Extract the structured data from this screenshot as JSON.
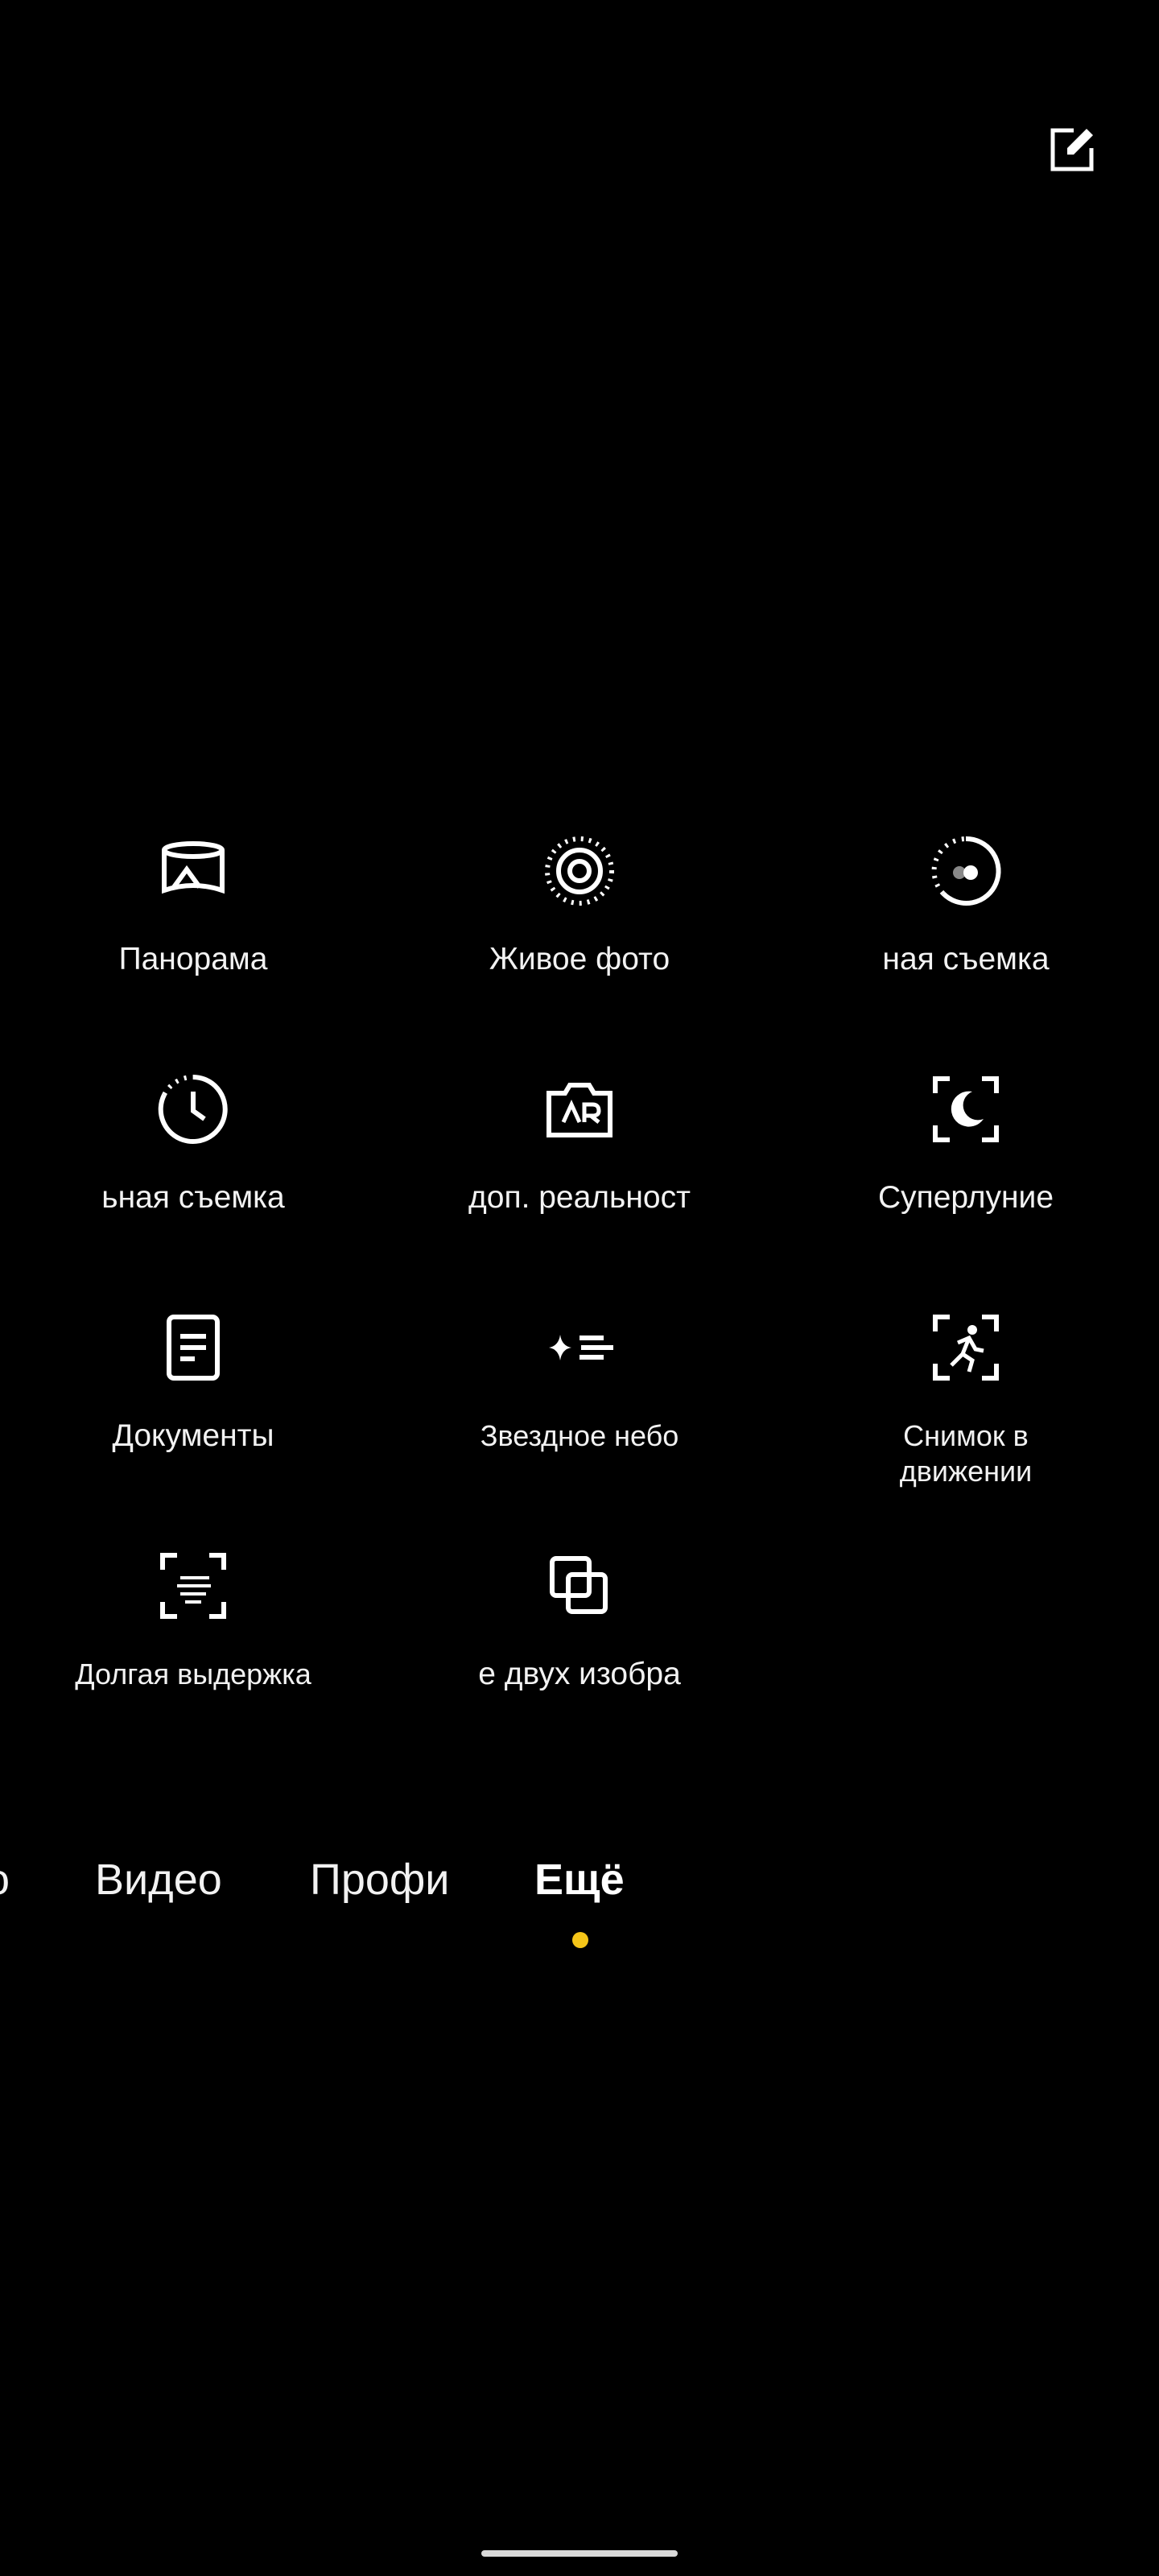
{
  "header": {
    "edit_icon": "edit-icon"
  },
  "modes": [
    {
      "label": "Панорама",
      "icon": "panorama-icon"
    },
    {
      "label": "Живое фото",
      "icon": "live-photo-icon"
    },
    {
      "label": "ная съемка",
      "icon": "dual-view-icon"
    },
    {
      "label": "ьная съемка",
      "icon": "timelapse-icon"
    },
    {
      "label": "доп. реальност",
      "icon": "ar-camera-icon"
    },
    {
      "label": "Суперлуние",
      "icon": "super-moon-icon"
    },
    {
      "label": "Документы",
      "icon": "document-icon"
    },
    {
      "label": "Звездное небо",
      "icon": "starry-sky-icon"
    },
    {
      "label": "Снимок в движении",
      "icon": "motion-shot-icon"
    },
    {
      "label": "Долгая выдержка",
      "icon": "long-exposure-icon"
    },
    {
      "label": "е двух изобра",
      "icon": "dual-image-icon"
    }
  ],
  "tabs": [
    {
      "label": "о"
    },
    {
      "label": "Видео"
    },
    {
      "label": "Профи"
    },
    {
      "label": "Ещё",
      "active": true
    }
  ],
  "colors": {
    "accent": "#f5c518",
    "background": "#000000",
    "text": "#ffffff"
  }
}
